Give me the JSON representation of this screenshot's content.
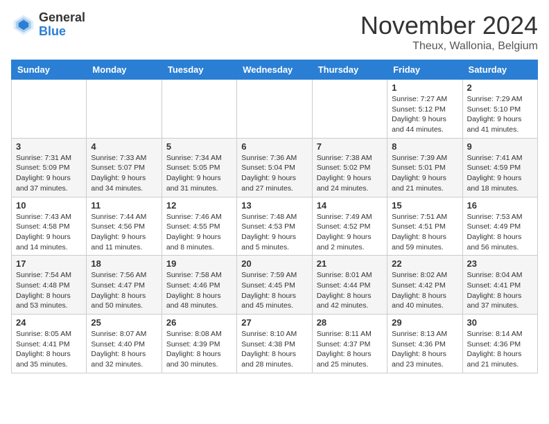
{
  "logo": {
    "general": "General",
    "blue": "Blue"
  },
  "header": {
    "month": "November 2024",
    "location": "Theux, Wallonia, Belgium"
  },
  "weekdays": [
    "Sunday",
    "Monday",
    "Tuesday",
    "Wednesday",
    "Thursday",
    "Friday",
    "Saturday"
  ],
  "weeks": [
    [
      {
        "day": "",
        "info": ""
      },
      {
        "day": "",
        "info": ""
      },
      {
        "day": "",
        "info": ""
      },
      {
        "day": "",
        "info": ""
      },
      {
        "day": "",
        "info": ""
      },
      {
        "day": "1",
        "info": "Sunrise: 7:27 AM\nSunset: 5:12 PM\nDaylight: 9 hours and 44 minutes."
      },
      {
        "day": "2",
        "info": "Sunrise: 7:29 AM\nSunset: 5:10 PM\nDaylight: 9 hours and 41 minutes."
      }
    ],
    [
      {
        "day": "3",
        "info": "Sunrise: 7:31 AM\nSunset: 5:09 PM\nDaylight: 9 hours and 37 minutes."
      },
      {
        "day": "4",
        "info": "Sunrise: 7:33 AM\nSunset: 5:07 PM\nDaylight: 9 hours and 34 minutes."
      },
      {
        "day": "5",
        "info": "Sunrise: 7:34 AM\nSunset: 5:05 PM\nDaylight: 9 hours and 31 minutes."
      },
      {
        "day": "6",
        "info": "Sunrise: 7:36 AM\nSunset: 5:04 PM\nDaylight: 9 hours and 27 minutes."
      },
      {
        "day": "7",
        "info": "Sunrise: 7:38 AM\nSunset: 5:02 PM\nDaylight: 9 hours and 24 minutes."
      },
      {
        "day": "8",
        "info": "Sunrise: 7:39 AM\nSunset: 5:01 PM\nDaylight: 9 hours and 21 minutes."
      },
      {
        "day": "9",
        "info": "Sunrise: 7:41 AM\nSunset: 4:59 PM\nDaylight: 9 hours and 18 minutes."
      }
    ],
    [
      {
        "day": "10",
        "info": "Sunrise: 7:43 AM\nSunset: 4:58 PM\nDaylight: 9 hours and 14 minutes."
      },
      {
        "day": "11",
        "info": "Sunrise: 7:44 AM\nSunset: 4:56 PM\nDaylight: 9 hours and 11 minutes."
      },
      {
        "day": "12",
        "info": "Sunrise: 7:46 AM\nSunset: 4:55 PM\nDaylight: 9 hours and 8 minutes."
      },
      {
        "day": "13",
        "info": "Sunrise: 7:48 AM\nSunset: 4:53 PM\nDaylight: 9 hours and 5 minutes."
      },
      {
        "day": "14",
        "info": "Sunrise: 7:49 AM\nSunset: 4:52 PM\nDaylight: 9 hours and 2 minutes."
      },
      {
        "day": "15",
        "info": "Sunrise: 7:51 AM\nSunset: 4:51 PM\nDaylight: 8 hours and 59 minutes."
      },
      {
        "day": "16",
        "info": "Sunrise: 7:53 AM\nSunset: 4:49 PM\nDaylight: 8 hours and 56 minutes."
      }
    ],
    [
      {
        "day": "17",
        "info": "Sunrise: 7:54 AM\nSunset: 4:48 PM\nDaylight: 8 hours and 53 minutes."
      },
      {
        "day": "18",
        "info": "Sunrise: 7:56 AM\nSunset: 4:47 PM\nDaylight: 8 hours and 50 minutes."
      },
      {
        "day": "19",
        "info": "Sunrise: 7:58 AM\nSunset: 4:46 PM\nDaylight: 8 hours and 48 minutes."
      },
      {
        "day": "20",
        "info": "Sunrise: 7:59 AM\nSunset: 4:45 PM\nDaylight: 8 hours and 45 minutes."
      },
      {
        "day": "21",
        "info": "Sunrise: 8:01 AM\nSunset: 4:44 PM\nDaylight: 8 hours and 42 minutes."
      },
      {
        "day": "22",
        "info": "Sunrise: 8:02 AM\nSunset: 4:42 PM\nDaylight: 8 hours and 40 minutes."
      },
      {
        "day": "23",
        "info": "Sunrise: 8:04 AM\nSunset: 4:41 PM\nDaylight: 8 hours and 37 minutes."
      }
    ],
    [
      {
        "day": "24",
        "info": "Sunrise: 8:05 AM\nSunset: 4:41 PM\nDaylight: 8 hours and 35 minutes."
      },
      {
        "day": "25",
        "info": "Sunrise: 8:07 AM\nSunset: 4:40 PM\nDaylight: 8 hours and 32 minutes."
      },
      {
        "day": "26",
        "info": "Sunrise: 8:08 AM\nSunset: 4:39 PM\nDaylight: 8 hours and 30 minutes."
      },
      {
        "day": "27",
        "info": "Sunrise: 8:10 AM\nSunset: 4:38 PM\nDaylight: 8 hours and 28 minutes."
      },
      {
        "day": "28",
        "info": "Sunrise: 8:11 AM\nSunset: 4:37 PM\nDaylight: 8 hours and 25 minutes."
      },
      {
        "day": "29",
        "info": "Sunrise: 8:13 AM\nSunset: 4:36 PM\nDaylight: 8 hours and 23 minutes."
      },
      {
        "day": "30",
        "info": "Sunrise: 8:14 AM\nSunset: 4:36 PM\nDaylight: 8 hours and 21 minutes."
      }
    ]
  ]
}
